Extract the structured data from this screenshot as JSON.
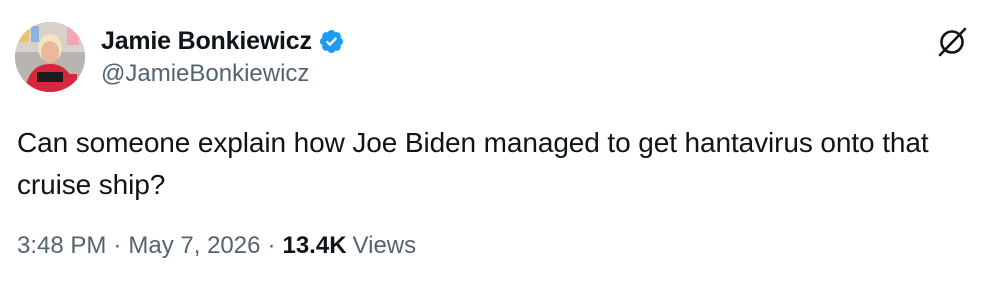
{
  "author": {
    "display_name": "Jamie Bonkiewicz",
    "handle": "@JamieBonkiewicz",
    "verified": true,
    "verified_icon": "verified-badge-icon",
    "avatar_icon": "avatar"
  },
  "tweet": {
    "text": "Can someone explain how Joe Biden managed to get hantavirus onto that cruise ship?",
    "time": "3:48 PM",
    "date": "May 7, 2026",
    "views_count": "13.4K",
    "views_label": "Views",
    "separator": "·"
  },
  "brand": {
    "logo_icon": "x-logo-icon"
  },
  "colors": {
    "text_primary": "#0f1419",
    "text_secondary": "#536471",
    "verified_blue": "#1d9bf0",
    "background": "#ffffff"
  }
}
